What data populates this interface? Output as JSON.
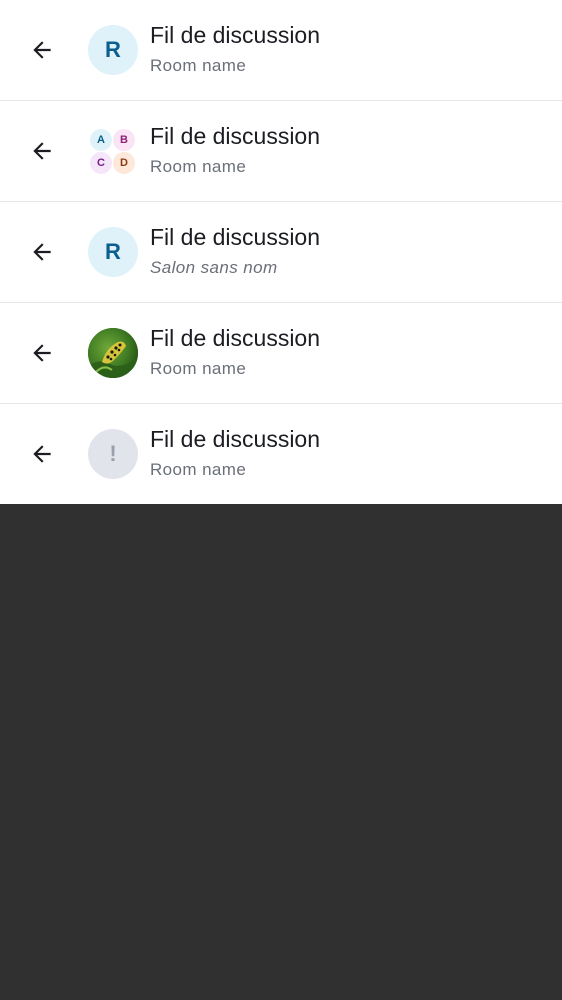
{
  "threads": [
    {
      "title": "Fil de discussion",
      "subtitle": "Room name",
      "avatar_type": "letter",
      "avatar_letter": "R",
      "back_icon": "arrow-left-icon"
    },
    {
      "title": "Fil de discussion",
      "subtitle": "Room name",
      "avatar_type": "multi",
      "avatar_letters": [
        "A",
        "B",
        "C",
        "D"
      ],
      "back_icon": "arrow-left-icon"
    },
    {
      "title": "Fil de discussion",
      "subtitle": "Salon sans nom",
      "avatar_type": "letter",
      "avatar_letter": "R",
      "back_icon": "arrow-left-icon"
    },
    {
      "title": "Fil de discussion",
      "subtitle": "Room name",
      "avatar_type": "photo",
      "avatar_icon": "caterpillar-photo",
      "back_icon": "arrow-left-icon"
    },
    {
      "title": "Fil de discussion",
      "subtitle": "Room name",
      "avatar_type": "unknown",
      "avatar_letter": "!",
      "back_icon": "arrow-left-icon"
    }
  ],
  "colors": {
    "background": "#303030",
    "row_background": "#ffffff",
    "divider": "#e4e6ea",
    "title": "#1b1d22",
    "subtitle": "#6a6f78",
    "avatar_blue_bg": "#e0f2f9",
    "avatar_blue_fg": "#0b5f8e"
  }
}
